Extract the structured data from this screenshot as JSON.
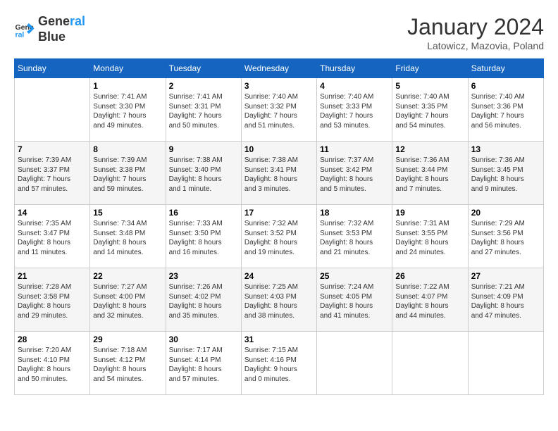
{
  "header": {
    "logo_line1": "General",
    "logo_line2": "Blue",
    "month": "January 2024",
    "location": "Latowicz, Mazovia, Poland"
  },
  "columns": [
    "Sunday",
    "Monday",
    "Tuesday",
    "Wednesday",
    "Thursday",
    "Friday",
    "Saturday"
  ],
  "weeks": [
    [
      {
        "day": "",
        "content": ""
      },
      {
        "day": "1",
        "content": "Sunrise: 7:41 AM\nSunset: 3:30 PM\nDaylight: 7 hours\nand 49 minutes."
      },
      {
        "day": "2",
        "content": "Sunrise: 7:41 AM\nSunset: 3:31 PM\nDaylight: 7 hours\nand 50 minutes."
      },
      {
        "day": "3",
        "content": "Sunrise: 7:40 AM\nSunset: 3:32 PM\nDaylight: 7 hours\nand 51 minutes."
      },
      {
        "day": "4",
        "content": "Sunrise: 7:40 AM\nSunset: 3:33 PM\nDaylight: 7 hours\nand 53 minutes."
      },
      {
        "day": "5",
        "content": "Sunrise: 7:40 AM\nSunset: 3:35 PM\nDaylight: 7 hours\nand 54 minutes."
      },
      {
        "day": "6",
        "content": "Sunrise: 7:40 AM\nSunset: 3:36 PM\nDaylight: 7 hours\nand 56 minutes."
      }
    ],
    [
      {
        "day": "7",
        "content": "Sunrise: 7:39 AM\nSunset: 3:37 PM\nDaylight: 7 hours\nand 57 minutes."
      },
      {
        "day": "8",
        "content": "Sunrise: 7:39 AM\nSunset: 3:38 PM\nDaylight: 7 hours\nand 59 minutes."
      },
      {
        "day": "9",
        "content": "Sunrise: 7:38 AM\nSunset: 3:40 PM\nDaylight: 8 hours\nand 1 minute."
      },
      {
        "day": "10",
        "content": "Sunrise: 7:38 AM\nSunset: 3:41 PM\nDaylight: 8 hours\nand 3 minutes."
      },
      {
        "day": "11",
        "content": "Sunrise: 7:37 AM\nSunset: 3:42 PM\nDaylight: 8 hours\nand 5 minutes."
      },
      {
        "day": "12",
        "content": "Sunrise: 7:36 AM\nSunset: 3:44 PM\nDaylight: 8 hours\nand 7 minutes."
      },
      {
        "day": "13",
        "content": "Sunrise: 7:36 AM\nSunset: 3:45 PM\nDaylight: 8 hours\nand 9 minutes."
      }
    ],
    [
      {
        "day": "14",
        "content": "Sunrise: 7:35 AM\nSunset: 3:47 PM\nDaylight: 8 hours\nand 11 minutes."
      },
      {
        "day": "15",
        "content": "Sunrise: 7:34 AM\nSunset: 3:48 PM\nDaylight: 8 hours\nand 14 minutes."
      },
      {
        "day": "16",
        "content": "Sunrise: 7:33 AM\nSunset: 3:50 PM\nDaylight: 8 hours\nand 16 minutes."
      },
      {
        "day": "17",
        "content": "Sunrise: 7:32 AM\nSunset: 3:52 PM\nDaylight: 8 hours\nand 19 minutes."
      },
      {
        "day": "18",
        "content": "Sunrise: 7:32 AM\nSunset: 3:53 PM\nDaylight: 8 hours\nand 21 minutes."
      },
      {
        "day": "19",
        "content": "Sunrise: 7:31 AM\nSunset: 3:55 PM\nDaylight: 8 hours\nand 24 minutes."
      },
      {
        "day": "20",
        "content": "Sunrise: 7:29 AM\nSunset: 3:56 PM\nDaylight: 8 hours\nand 27 minutes."
      }
    ],
    [
      {
        "day": "21",
        "content": "Sunrise: 7:28 AM\nSunset: 3:58 PM\nDaylight: 8 hours\nand 29 minutes."
      },
      {
        "day": "22",
        "content": "Sunrise: 7:27 AM\nSunset: 4:00 PM\nDaylight: 8 hours\nand 32 minutes."
      },
      {
        "day": "23",
        "content": "Sunrise: 7:26 AM\nSunset: 4:02 PM\nDaylight: 8 hours\nand 35 minutes."
      },
      {
        "day": "24",
        "content": "Sunrise: 7:25 AM\nSunset: 4:03 PM\nDaylight: 8 hours\nand 38 minutes."
      },
      {
        "day": "25",
        "content": "Sunrise: 7:24 AM\nSunset: 4:05 PM\nDaylight: 8 hours\nand 41 minutes."
      },
      {
        "day": "26",
        "content": "Sunrise: 7:22 AM\nSunset: 4:07 PM\nDaylight: 8 hours\nand 44 minutes."
      },
      {
        "day": "27",
        "content": "Sunrise: 7:21 AM\nSunset: 4:09 PM\nDaylight: 8 hours\nand 47 minutes."
      }
    ],
    [
      {
        "day": "28",
        "content": "Sunrise: 7:20 AM\nSunset: 4:10 PM\nDaylight: 8 hours\nand 50 minutes."
      },
      {
        "day": "29",
        "content": "Sunrise: 7:18 AM\nSunset: 4:12 PM\nDaylight: 8 hours\nand 54 minutes."
      },
      {
        "day": "30",
        "content": "Sunrise: 7:17 AM\nSunset: 4:14 PM\nDaylight: 8 hours\nand 57 minutes."
      },
      {
        "day": "31",
        "content": "Sunrise: 7:15 AM\nSunset: 4:16 PM\nDaylight: 9 hours\nand 0 minutes."
      },
      {
        "day": "",
        "content": ""
      },
      {
        "day": "",
        "content": ""
      },
      {
        "day": "",
        "content": ""
      }
    ]
  ]
}
